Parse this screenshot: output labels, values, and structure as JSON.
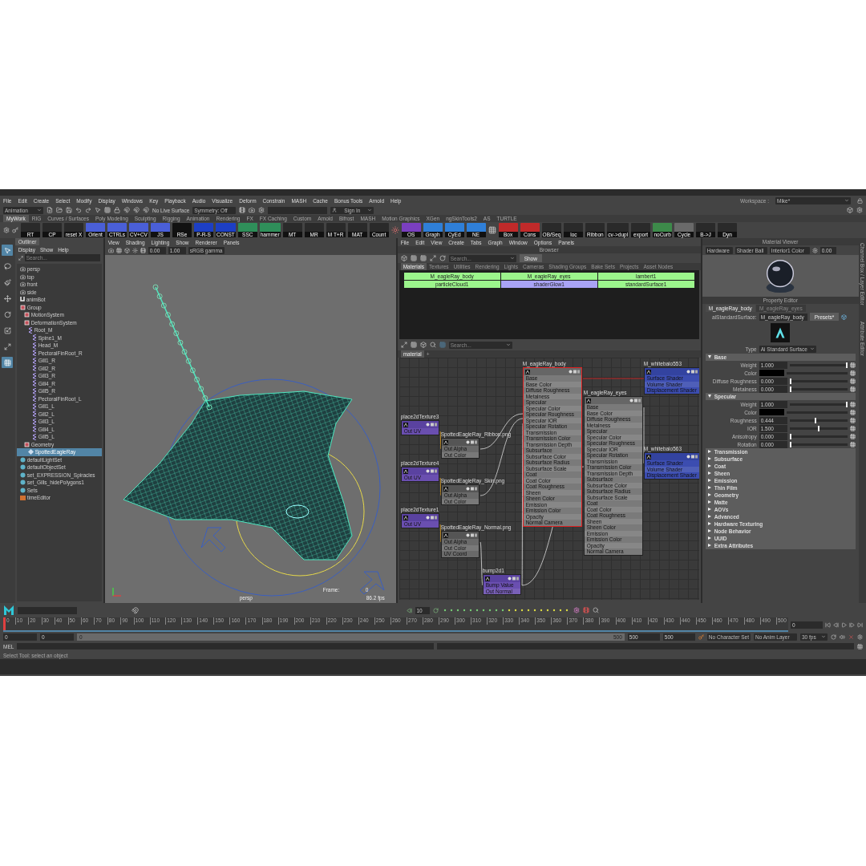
{
  "menubar": [
    "File",
    "Edit",
    "Create",
    "Select",
    "Modify",
    "Display",
    "Windows",
    "Key",
    "Playback",
    "Audio",
    "Visualize",
    "Deform",
    "Constrain",
    "MASH",
    "Cache",
    "Bonus Tools",
    "Arnold",
    "Help"
  ],
  "workspace": {
    "label": "Workspace :",
    "value": "Mike*"
  },
  "status_line": {
    "mode": "Animation",
    "live_surface": "No Live Surface",
    "symmetry": "Symmetry: Off",
    "sign_in": "Sign In"
  },
  "shelf_tabs": [
    {
      "label": "MyWork",
      "selected": true
    },
    {
      "label": "RIG",
      "selected": false
    },
    {
      "label": "Curves / Surfaces",
      "selected": false
    },
    {
      "label": "Poly Modeling",
      "selected": false
    },
    {
      "label": "Sculpting",
      "selected": false
    },
    {
      "label": "Rigging",
      "selected": false
    },
    {
      "label": "Animation",
      "selected": false
    },
    {
      "label": "Rendering",
      "selected": false
    },
    {
      "label": "FX",
      "selected": false
    },
    {
      "label": "FX Caching",
      "selected": false
    },
    {
      "label": "Custom",
      "selected": false
    },
    {
      "label": "Arnold",
      "selected": false
    },
    {
      "label": "Bifrost",
      "selected": false
    },
    {
      "label": "MASH",
      "selected": false
    },
    {
      "label": "Motion Graphics",
      "selected": false
    },
    {
      "label": "XGen",
      "selected": false
    },
    {
      "label": "ngSkinTools2",
      "selected": false
    },
    {
      "label": "AS",
      "selected": false
    },
    {
      "label": "TURTLE",
      "selected": false
    }
  ],
  "shelf": [
    {
      "label": "RT",
      "color": "#2a2a2a"
    },
    {
      "label": "CP",
      "color": "#2a2a2a"
    },
    {
      "label": "reset X",
      "color": "#2a2a2a"
    },
    {
      "label": "Orient",
      "color": "#4a5fd8"
    },
    {
      "label": "CTRLs",
      "color": "#4a5fd8"
    },
    {
      "label": "CV+CV",
      "color": "#4a5fd8"
    },
    {
      "label": "JS",
      "color": "#4a5fd8"
    },
    {
      "label": "RSe",
      "color": "#111111"
    },
    {
      "label": "P-R-S",
      "color": "#1d3fc4"
    },
    {
      "label": "CONST",
      "color": "#1d3fc4"
    },
    {
      "label": "SSC",
      "color": "#2f8f5a"
    },
    {
      "label": "hammer",
      "color": "#2f8f5a"
    },
    {
      "label": "MT",
      "color": "#2a2a2a"
    },
    {
      "label": "MR",
      "color": "#2a2a2a"
    },
    {
      "label": "M T+R",
      "color": "#2a2a2a"
    },
    {
      "label": "MAT",
      "color": "#2a2a2a"
    },
    {
      "label": "Count",
      "color": "#2a2a2a"
    },
    {
      "label": "OS",
      "color": "#7a3fc0"
    },
    {
      "label": "Graph",
      "color": "#2f7fd8"
    },
    {
      "label": "CyEd",
      "color": "#2f7fd8"
    },
    {
      "label": "NE",
      "color": "#2f7fd8"
    },
    {
      "label": "Box",
      "color": "#c02a2a"
    },
    {
      "label": "Cons",
      "color": "#c02a2a"
    },
    {
      "label": "OB/Seq",
      "color": "#2a2a2a"
    },
    {
      "label": "loc",
      "color": "#2a2a2a"
    },
    {
      "label": "Ribbon",
      "color": "#2a2a2a"
    },
    {
      "label": "cv->dupl",
      "color": "#2a2a2a"
    },
    {
      "label": "export",
      "color": "#2a2a2a"
    },
    {
      "label": "noCurb",
      "color": "#3d8a4a"
    },
    {
      "label": "Cycle",
      "color": "#6a6a6a"
    },
    {
      "label": "B->J",
      "color": "#2a2a2a"
    },
    {
      "label": "Dyn",
      "color": "#2a2a2a"
    }
  ],
  "outliner": {
    "title": "Outliner",
    "menus": [
      "Display",
      "Show",
      "Help"
    ],
    "search": {
      "placeholder": "Search..."
    },
    "items": [
      {
        "label": "persp",
        "kind": "camera",
        "selected": false
      },
      {
        "label": "top",
        "kind": "camera",
        "selected": false
      },
      {
        "label": "front",
        "kind": "camera",
        "selected": false
      },
      {
        "label": "side",
        "kind": "camera",
        "selected": false
      },
      {
        "label": "animBot",
        "kind": "anim",
        "selected": false
      },
      {
        "label": "Group",
        "kind": "group",
        "selected": false,
        "children": [
          {
            "label": "MotionSystem",
            "kind": "group",
            "selected": false
          },
          {
            "label": "DeformationSystem",
            "kind": "group",
            "selected": false,
            "children": [
              {
                "label": "Root_M",
                "kind": "joint",
                "selected": false,
                "children": [
                  {
                    "label": "Spine1_M",
                    "kind": "joint",
                    "selected": false
                  },
                  {
                    "label": "Head_M",
                    "kind": "joint",
                    "selected": false
                  },
                  {
                    "label": "PectoralFinRoot_R",
                    "kind": "joint",
                    "selected": false
                  },
                  {
                    "label": "Gill1_R",
                    "kind": "joint",
                    "selected": false
                  },
                  {
                    "label": "Gill2_R",
                    "kind": "joint",
                    "selected": false
                  },
                  {
                    "label": "Gill3_R",
                    "kind": "joint",
                    "selected": false
                  },
                  {
                    "label": "Gill4_R",
                    "kind": "joint",
                    "selected": false
                  },
                  {
                    "label": "Gill5_R",
                    "kind": "joint",
                    "selected": false
                  },
                  {
                    "label": "PectoralFinRoot_L",
                    "kind": "joint",
                    "selected": false
                  },
                  {
                    "label": "Gill1_L",
                    "kind": "joint",
                    "selected": false
                  },
                  {
                    "label": "Gill2_L",
                    "kind": "joint",
                    "selected": false
                  },
                  {
                    "label": "Gill3_L",
                    "kind": "joint",
                    "selected": false
                  },
                  {
                    "label": "Gill4_L",
                    "kind": "joint",
                    "selected": false
                  },
                  {
                    "label": "Gill5_L",
                    "kind": "joint",
                    "selected": false
                  }
                ]
              }
            ]
          },
          {
            "label": "Geometry",
            "kind": "group",
            "selected": false,
            "children": [
              {
                "label": "SpottedEagleRay",
                "kind": "mesh",
                "selected": true
              }
            ]
          }
        ]
      },
      {
        "label": "defaultLightSet",
        "kind": "set",
        "selected": false
      },
      {
        "label": "defaultObjectSet",
        "kind": "set",
        "selected": false
      },
      {
        "label": "set_EXPRESSION_Spiracles",
        "kind": "set",
        "selected": false
      },
      {
        "label": "set_Gills_hidePolygons1",
        "kind": "set",
        "selected": false
      },
      {
        "label": "Sets",
        "kind": "set",
        "selected": false
      },
      {
        "label": "timeEditor",
        "kind": "editor",
        "selected": false
      }
    ]
  },
  "viewport": {
    "menus": [
      "View",
      "Shading",
      "Lighting",
      "Show",
      "Renderer",
      "Panels"
    ],
    "fields": [
      "0.00",
      "1.00"
    ],
    "color_space": "sRGB gamma",
    "camera": "persp",
    "frame_label": "Frame:",
    "frame": "0",
    "fps": "86.2 fps"
  },
  "hypershade": {
    "menus": [
      "File",
      "Edit",
      "View",
      "Create",
      "Tabs",
      "Graph",
      "Window",
      "Options",
      "Panels"
    ],
    "browser_title": "Browser",
    "search": {
      "placeholder": "Search..."
    },
    "show_button": "Show",
    "tabs": [
      {
        "label": "Materials",
        "selected": true
      },
      {
        "label": "Textures",
        "selected": false
      },
      {
        "label": "Utilities",
        "selected": false
      },
      {
        "label": "Rendering",
        "selected": false
      },
      {
        "label": "Lights",
        "selected": false
      },
      {
        "label": "Cameras",
        "selected": false
      },
      {
        "label": "Shading Groups",
        "selected": false
      },
      {
        "label": "Bake Sets",
        "selected": false
      },
      {
        "label": "Projects",
        "selected": false
      },
      {
        "label": "Asset Nodes",
        "selected": false
      }
    ],
    "materials": [
      {
        "name": "M_eagleRay_body",
        "color": "#9cf58c"
      },
      {
        "name": "M_eagleRay_eyes",
        "color": "#9cf58c"
      },
      {
        "name": "lambert1",
        "color": "#9cf58c"
      },
      {
        "name": "particleCloud1",
        "color": "#9cf58c"
      },
      {
        "name": "shaderGlow1",
        "color": "#a9a3f5"
      },
      {
        "name": "standardSurface1",
        "color": "#9cf58c"
      }
    ],
    "editor_search": {
      "placeholder": "Search..."
    },
    "graph_tabs": [
      "material",
      "+"
    ],
    "nodes": [
      {
        "name": "M_eagleRay_body",
        "kind": "shader",
        "selected": true,
        "attributes": [
          "Base",
          "Base Color",
          "Diffuse Roughness",
          "Metalness",
          "Specular",
          "Specular Color",
          "Specular Roughness",
          "Specular IOR",
          "Specular Rotation",
          "Transmission",
          "Transmission Color",
          "Transmission Depth",
          "Subsurface",
          "Subsurface Color",
          "Subsurface Radius",
          "Subsurface Scale",
          "Coat",
          "Coat Color",
          "Coat Roughness",
          "Sheen",
          "Sheen Color",
          "Emission",
          "Emission Color",
          "Opacity",
          "Normal Camera"
        ]
      },
      {
        "name": "M_whitebalo553",
        "kind": "engine",
        "selected": false,
        "attributes": [
          "Surface Shader",
          "Volume Shader",
          "Displacement Shader"
        ]
      },
      {
        "name": "place2dTexture3",
        "kind": "place",
        "selected": false,
        "attributes": [
          "Out UV"
        ]
      },
      {
        "name": "SpottedEagleRay_Ribbon.png",
        "kind": "file",
        "selected": false,
        "attributes": [
          "Out Alpha",
          "Out Color"
        ]
      },
      {
        "name": "place2dTexture4",
        "kind": "place",
        "selected": false,
        "attributes": [
          "Out UV"
        ]
      },
      {
        "name": "SpottedEagleRay_Skin.png",
        "kind": "file",
        "selected": false,
        "attributes": [
          "Out Alpha",
          "Out Color"
        ]
      },
      {
        "name": "place2dTexture1",
        "kind": "place",
        "selected": false,
        "attributes": [
          "Out UV"
        ]
      },
      {
        "name": "SpottedEagleRay_Normal.png",
        "kind": "file",
        "selected": false,
        "attributes": [
          "Out Alpha",
          "Out Color",
          "UV Coord"
        ]
      },
      {
        "name": "bump2d1",
        "kind": "place",
        "selected": false,
        "attributes": [
          "Bump Value",
          "Out Normal"
        ]
      },
      {
        "name": "M_eagleRay_eyes",
        "kind": "shader",
        "selected": false,
        "attributes": [
          "Base",
          "Base Color",
          "Diffuse Roughness",
          "Metalness",
          "Specular",
          "Specular Color",
          "Specular Roughness",
          "Specular IOR",
          "Specular Rotation",
          "Transmission",
          "Transmission Color",
          "Transmission Depth",
          "Subsurface",
          "Subsurface Color",
          "Subsurface Radius",
          "Subsurface Scale",
          "Coat",
          "Coat Color",
          "Coat Roughness",
          "Sheen",
          "Sheen Color",
          "Emission",
          "Emission Color",
          "Opacity",
          "Normal Camera"
        ]
      },
      {
        "name": "M_whitebalo563",
        "kind": "engine",
        "selected": false,
        "attributes": [
          "Surface Shader",
          "Volume Shader",
          "Displacement Shader"
        ]
      }
    ]
  },
  "material_viewer": {
    "title": "Material Viewer",
    "renderer": "Hardware",
    "geometry": "Shader Ball",
    "environment": "Interior1 Color",
    "exposure": "0.00"
  },
  "property_editor": {
    "title": "Property Editor",
    "tabs": [
      {
        "label": "M_eagleRay_body",
        "selected": true
      },
      {
        "label": "M_eagleRay_eyes",
        "selected": false
      }
    ],
    "node_type_label": "aiStandardSurface:",
    "node_name": "M_eagleRay_body",
    "presets": "Presets*",
    "type_label": "Type",
    "type_value": "Ai Standard Surface",
    "sections": [
      {
        "title": "Base",
        "expanded": true,
        "attributes": [
          {
            "kind": "slider",
            "label": "Weight",
            "value": "1.000",
            "level": 1
          },
          {
            "kind": "color",
            "label": "Color",
            "color": "#000000"
          },
          {
            "kind": "slider",
            "label": "Diffuse Roughness",
            "value": "0.000",
            "level": 0
          },
          {
            "kind": "slider",
            "label": "Metalness",
            "value": "0.000",
            "level": 0
          }
        ]
      },
      {
        "title": "Specular",
        "expanded": true,
        "attributes": [
          {
            "kind": "slider",
            "label": "Weight",
            "value": "1.000",
            "level": 1
          },
          {
            "kind": "color",
            "label": "Color",
            "color": "#000000"
          },
          {
            "kind": "slider",
            "label": "Roughness",
            "value": "0.444",
            "level": 0.444
          },
          {
            "kind": "slider",
            "label": "IOR",
            "value": "1.500",
            "level": 0.5
          },
          {
            "kind": "slider",
            "label": "Anisotropy",
            "value": "0.000",
            "level": 0
          },
          {
            "kind": "slider",
            "label": "Rotation",
            "value": "0.000",
            "level": 0
          }
        ]
      },
      {
        "title": "Transmission",
        "expanded": false
      },
      {
        "title": "Subsurface",
        "expanded": false
      },
      {
        "title": "Coat",
        "expanded": false
      },
      {
        "title": "Sheen",
        "expanded": false
      },
      {
        "title": "Emission",
        "expanded": false
      },
      {
        "title": "Thin Film",
        "expanded": false
      },
      {
        "title": "Geometry",
        "expanded": false
      },
      {
        "title": "Matte",
        "expanded": false
      },
      {
        "title": "AOVs",
        "expanded": false
      },
      {
        "title": "Advanced",
        "expanded": false
      },
      {
        "title": "Hardware Texturing",
        "expanded": false
      },
      {
        "title": "Node Behavior",
        "expanded": false
      },
      {
        "title": "UUID",
        "expanded": false
      },
      {
        "title": "Extra Attributes",
        "expanded": false
      }
    ]
  },
  "side_tabs": [
    "Channel Box / Layer Editor",
    "Attribute Editor"
  ],
  "playback": {
    "step": "10"
  },
  "timeline": {
    "ticks": [
      "0",
      "10",
      "20",
      "30",
      "40",
      "50",
      "60",
      "70",
      "80",
      "90",
      "100",
      "110",
      "120",
      "130",
      "140",
      "150",
      "160",
      "170",
      "180",
      "190",
      "200",
      "210",
      "220",
      "230",
      "240",
      "250",
      "260",
      "270",
      "280",
      "290",
      "300",
      "310",
      "320",
      "330",
      "340",
      "350",
      "360",
      "370",
      "380",
      "390",
      "400",
      "410",
      "420",
      "430",
      "440",
      "450",
      "460",
      "470",
      "480",
      "490",
      "500"
    ],
    "current_frame": "0",
    "level": 0
  },
  "range": {
    "level": 1,
    "start": "0",
    "anim_start": "0",
    "slider_start": "0",
    "slider_end": "500",
    "anim_end": "500",
    "end": "500",
    "character_set": "No Character Set",
    "anim_layer": "No Anim Layer",
    "fps": "30 fps"
  },
  "command_line": {
    "label": "MEL"
  },
  "help_line": "Select Tool: select an object"
}
